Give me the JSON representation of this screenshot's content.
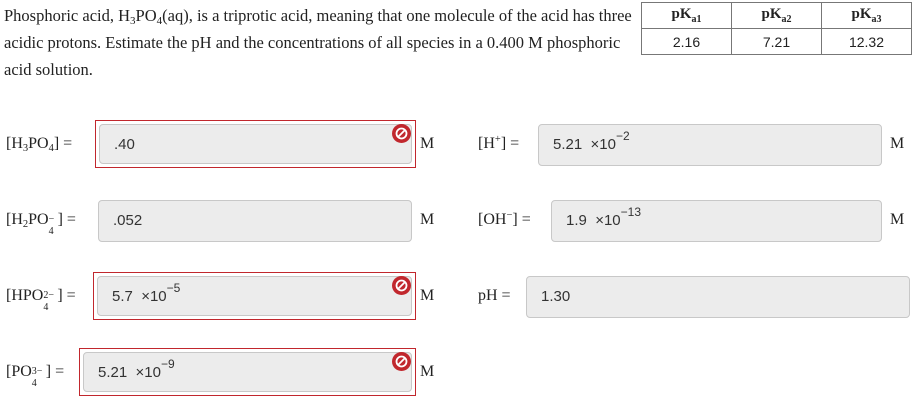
{
  "problem": {
    "text_a": "Phosphoric acid, H",
    "sub_3": "3",
    "text_b": "PO",
    "sub_4": "4",
    "text_c": "(aq), is a triprotic acid, meaning that one molecule of the acid has three acidic protons. Estimate the pH and the concentrations of all species in a 0.400 M phosphoric acid solution."
  },
  "pka_table": {
    "headers": [
      {
        "base": "pK",
        "sub": "a1"
      },
      {
        "base": "pK",
        "sub": "a2"
      },
      {
        "base": "pK",
        "sub": "a3"
      }
    ],
    "values": [
      "2.16",
      "7.21",
      "12.32"
    ]
  },
  "fields": {
    "h3po4": {
      "value": ".40",
      "status": "incorrect",
      "unit": "M"
    },
    "h2po4": {
      "value": ".052",
      "status": "none",
      "unit": "M"
    },
    "hpo4": {
      "mantissa": "5.7",
      "times": "×10",
      "exp": "−5",
      "status": "incorrect",
      "unit": "M"
    },
    "po4": {
      "mantissa": "5.21",
      "times": "×10",
      "exp": "−9",
      "status": "incorrect",
      "unit": "M"
    },
    "h_plus": {
      "mantissa": "5.21",
      "times": "×10",
      "exp": "−2",
      "status": "none",
      "unit": "M"
    },
    "oh_minus": {
      "mantissa": "1.9",
      "times": "×10",
      "exp": "−13",
      "status": "none",
      "unit": "M"
    },
    "ph": {
      "value": "1.30",
      "status": "none"
    }
  },
  "labels": {
    "h3po4": {
      "a": "[H",
      "s1": "3",
      "b": "PO",
      "s2": "4",
      "c": "] ="
    },
    "h2po4": {
      "a": "[H",
      "s1": "2",
      "b": "PO",
      "sup": "−",
      "sub": "4",
      "c": "] ="
    },
    "hpo4": {
      "a": "[HPO",
      "sup": "2−",
      "sub": "4",
      "c": "] ="
    },
    "po4": {
      "a": "[PO",
      "sup": "3−",
      "sub": "4",
      "c": "] ="
    },
    "h_plus": {
      "a": "[H",
      "sup": "+",
      "c": "] ="
    },
    "oh_minus": {
      "a": "[OH",
      "sup": "−",
      "c": "] ="
    },
    "ph": {
      "a": "pH ="
    }
  },
  "colors": {
    "incorrect": "#c1272d",
    "field_bg": "#ececec"
  },
  "icons": {
    "incorrect": "incorrect-icon"
  }
}
